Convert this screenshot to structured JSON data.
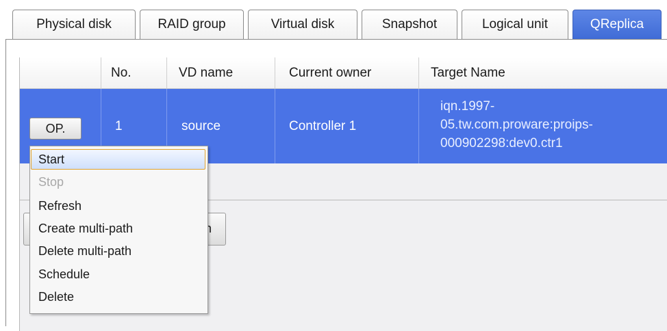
{
  "tabs": [
    {
      "label": "Physical disk"
    },
    {
      "label": "RAID group"
    },
    {
      "label": "Virtual disk"
    },
    {
      "label": "Snapshot"
    },
    {
      "label": "Logical unit"
    },
    {
      "label": "QReplica",
      "active": true
    }
  ],
  "table": {
    "columns": [
      "",
      "No.",
      "VD name",
      "Current owner",
      "Target Name"
    ],
    "rows": [
      {
        "op_label": "OP.",
        "no": "1",
        "vd_name": "source",
        "owner": "Controller 1",
        "target_lines": [
          "iqn.1997-",
          "05.tw.com.proware:proips-",
          "000902298:dev0.ctr1"
        ],
        "selected": true
      }
    ]
  },
  "below_button_text": "n",
  "context_menu": {
    "items": [
      {
        "label": "Start",
        "highlighted": true
      },
      {
        "label": "Stop",
        "disabled": true
      },
      {
        "label": "Refresh"
      },
      {
        "label": "Create multi-path"
      },
      {
        "label": "Delete multi-path"
      },
      {
        "label": "Schedule"
      },
      {
        "label": "Delete"
      }
    ]
  },
  "colors": {
    "active_tab": "#4a73e6",
    "selected_row": "#4a73e6",
    "menu_highlight_border": "#e0a22c"
  }
}
